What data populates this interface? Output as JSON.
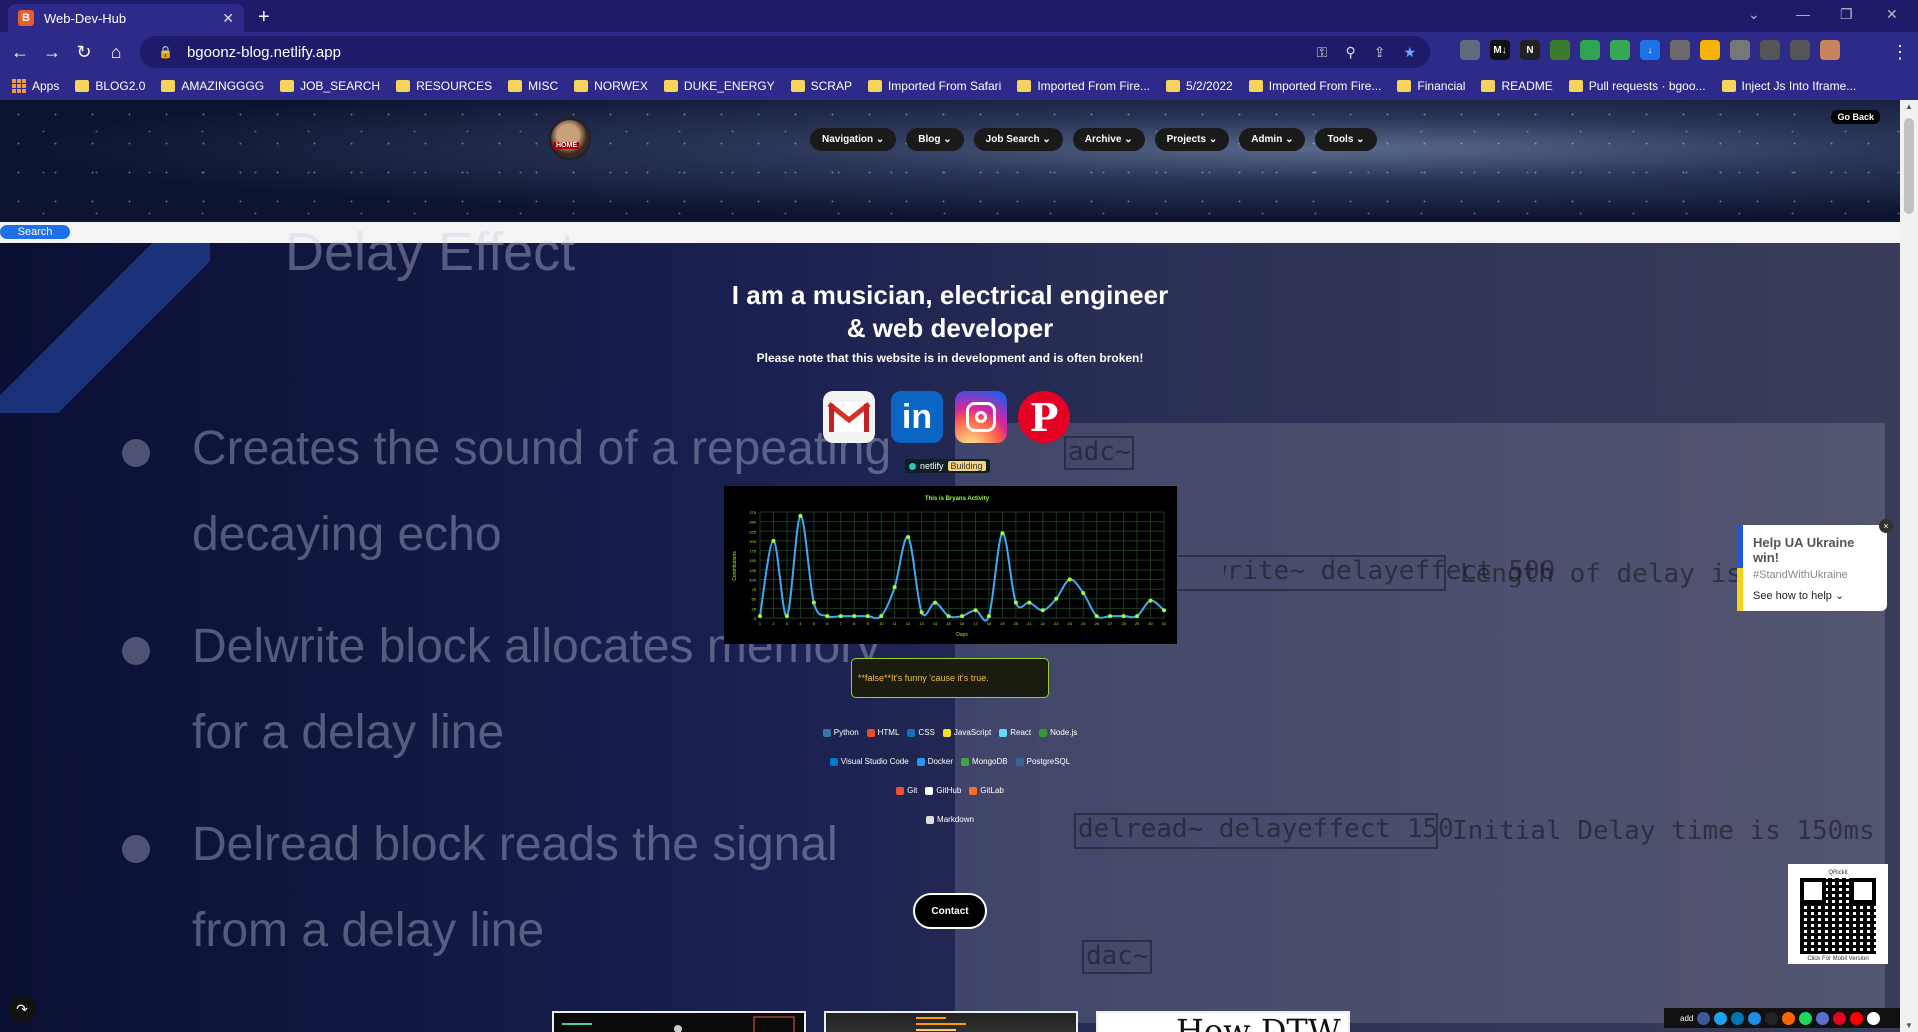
{
  "browser": {
    "tab_title": "Web-Dev-Hub",
    "url": "bgoonz-blog.netlify.app",
    "bookmarks": [
      "Apps",
      "BLOG2.0",
      "AMAZINGGGG",
      "JOB_SEARCH",
      "RESOURCES",
      "MISC",
      "NORWEX",
      "DUKE_ENERGY",
      "SCRAP",
      "Imported From Safari",
      "Imported From Fire...",
      "5/2/2022",
      "Imported From Fire...",
      "Financial",
      "README",
      "Pull requests · bgoo...",
      "Inject Js Into Iframe..."
    ],
    "extensions": [
      {
        "label": "",
        "color": "#5f6b7a"
      },
      {
        "label": "M↓",
        "color": "#111111"
      },
      {
        "label": "N",
        "color": "#222222"
      },
      {
        "label": "",
        "color": "#3a7c2c"
      },
      {
        "label": "",
        "color": "#2ea44f"
      },
      {
        "label": "",
        "color": "#34a853"
      },
      {
        "label": "↓",
        "color": "#1a73e8"
      },
      {
        "label": "",
        "color": "#6b6b6b"
      },
      {
        "label": "",
        "color": "#f4b400"
      },
      {
        "label": "",
        "color": "#777777"
      },
      {
        "label": "",
        "color": "#555555"
      },
      {
        "label": "",
        "color": "#555555"
      },
      {
        "label": "",
        "color": "#c8845a"
      }
    ]
  },
  "site": {
    "avatar_label": "HOME",
    "nav": [
      "Navigation ⌄",
      "Blog ⌄",
      "Job Search ⌄",
      "Archive ⌄",
      "Projects ⌄",
      "Admin ⌄",
      "Tools ⌄"
    ],
    "go_back": "Go Back",
    "search_button": "Search"
  },
  "background_slide": {
    "title_fragment": "Delay Effect",
    "bullets": [
      "Creates the sound of a repeating",
      "decaying echo",
      "Delwrite block allocates memory",
      "for a delay line",
      "Delread block reads the signal",
      "from a delay line"
    ],
    "code": [
      "adc~",
      "delwrite~ delayeffect 500",
      "Length of delay is",
      "delread~ delayeffect 150",
      "Initial Delay time is 150ms",
      "dac~"
    ]
  },
  "hero": {
    "headline_line1": "I am a musician, electrical engineer",
    "headline_line2": "& web developer",
    "note": "Please note that this website is in development and is often broken!"
  },
  "netlify_badge": {
    "label": "netlify",
    "status": "Building"
  },
  "chart_data": {
    "type": "line",
    "title": "This is Bryans Activity",
    "xlabel": "Days",
    "ylabel": "Contributions",
    "ylim": [
      0,
      275
    ],
    "y_ticks": [
      0,
      25,
      50,
      75,
      100,
      125,
      150,
      175,
      200,
      225,
      250,
      275
    ],
    "x": [
      1,
      2,
      3,
      4,
      5,
      6,
      7,
      8,
      9,
      10,
      11,
      12,
      13,
      14,
      15,
      16,
      17,
      18,
      19,
      20,
      21,
      22,
      23,
      24,
      25,
      26,
      27,
      28,
      29,
      30,
      31
    ],
    "series": [
      {
        "values": [
          5,
          200,
          5,
          265,
          40,
          5,
          5,
          5,
          5,
          5,
          80,
          210,
          15,
          40,
          5,
          5,
          20,
          5,
          220,
          40,
          40,
          20,
          50,
          100,
          65,
          5,
          5,
          5,
          5,
          45,
          20
        ]
      }
    ],
    "colors": {
      "line": "#3fa9f5",
      "points": "#9cff2e",
      "text": "#9cff2e",
      "grid": "#1f3a1f"
    },
    "grid": true
  },
  "quote": "**false**It's funny 'cause it's true.",
  "skills_rows": [
    [
      {
        "name": "Python",
        "color": "#3776ab"
      },
      {
        "name": "HTML",
        "color": "#e34f26"
      },
      {
        "name": "CSS",
        "color": "#1572b6"
      },
      {
        "name": "JavaScript",
        "color": "#f7df1e"
      },
      {
        "name": "React",
        "color": "#61dafb"
      },
      {
        "name": "Node.js",
        "color": "#339933"
      }
    ],
    [
      {
        "name": "Visual Studio Code",
        "color": "#007acc"
      },
      {
        "name": "Docker",
        "color": "#2496ed"
      },
      {
        "name": "MongoDB",
        "color": "#47a248"
      },
      {
        "name": "PostgreSQL",
        "color": "#336791"
      }
    ],
    [
      {
        "name": "Git",
        "color": "#f05032"
      },
      {
        "name": "GitHub",
        "color": "#ffffff"
      },
      {
        "name": "GitLab",
        "color": "#fc6d26"
      }
    ],
    [
      {
        "name": "Markdown",
        "color": "#dddddd"
      }
    ]
  ],
  "contact_button": "Contact",
  "thumbnails": {
    "third_text": "How DTW"
  },
  "ukraine_widget": {
    "title": "Help UA Ukraine win!",
    "hashtag": "#StandWithUkraine",
    "cta": "See how to help ⌄",
    "close": "×"
  },
  "qr": {
    "title": "QRickit",
    "caption": "Click For Mobil Version"
  },
  "share_bar": {
    "label": "add",
    "colors": [
      "#3b5998",
      "#1da1f2",
      "#0077b5",
      "#1d8de9",
      "#222222",
      "#ff6600",
      "#1ed760",
      "#5b6dcd",
      "#e60023",
      "#ff0000",
      "#ffffff"
    ]
  },
  "share_float_icon": "↷"
}
